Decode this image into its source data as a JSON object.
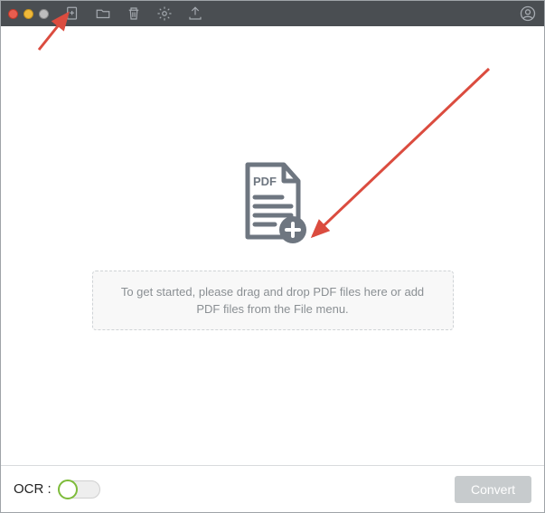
{
  "toolbar": {
    "icons": {
      "add_file": "add-file-icon",
      "open_folder": "folder-icon",
      "delete": "trash-icon",
      "settings": "gear-icon",
      "export": "upload-icon",
      "account": "user-icon"
    }
  },
  "main": {
    "pdf_badge": "PDF",
    "dropzone_text": "To get started, please drag and drop PDF files here or add PDF files from the File menu."
  },
  "footer": {
    "ocr_label": "OCR :",
    "ocr_on": false,
    "convert_label": "Convert",
    "convert_enabled": false
  },
  "colors": {
    "toolbar_bg": "#4a4e52",
    "icon": "#a5aab0",
    "dropzone_text": "#8a8f93",
    "switch_accent": "#7dbb3a",
    "arrow": "#db4c3f"
  }
}
